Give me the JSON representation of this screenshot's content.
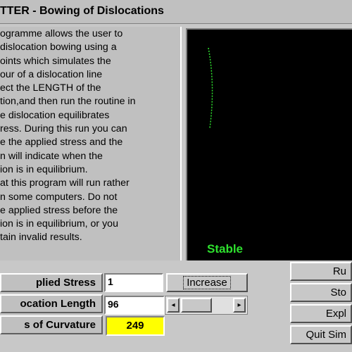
{
  "window": {
    "title": "TTER - Bowing of Dislocations"
  },
  "info": {
    "lines": [
      "ogramme allows the user to",
      "dislocation bowing using a",
      "oints which simulates the",
      "our of a dislocation line",
      "ect the LENGTH of the",
      "tion,and then run the routine in",
      "e dislocation equilibrates",
      "ress. During this run you can",
      "e the applied stress and the",
      "n will indicate when the",
      "ion is in equilibrium.",
      "at this program will run rather",
      "n some computers. Do not",
      "e applied stress before the",
      "ion is in equilibrium, or you",
      "tain invalid results."
    ]
  },
  "display": {
    "status": "Stable",
    "line_color": "#2ee02e"
  },
  "controls": {
    "applied_stress_label": "plied Stress",
    "applied_stress_value": "1",
    "increase_label": "Increase",
    "dislocation_length_label": "ocation Length",
    "dislocation_length_value": "96",
    "curvature_label": "s of Curvature",
    "curvature_value": "249",
    "scroll_left": "◂",
    "scroll_right": "▸"
  },
  "buttons": {
    "run": "Ru",
    "stop": "Sto",
    "explain": "Expl",
    "quit": "Quit Sim"
  }
}
